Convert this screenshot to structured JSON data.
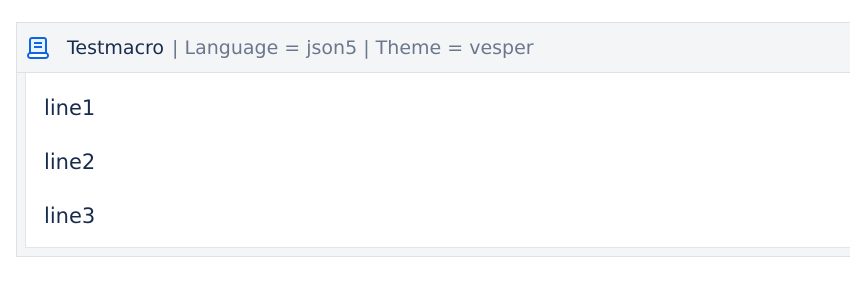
{
  "macro": {
    "icon": "scroll-icon",
    "title": "Testmacro",
    "meta": "| Language = json5 | Theme = vesper",
    "lines": [
      "line1",
      "line2",
      "line3"
    ]
  },
  "colors": {
    "title": "#172b4d",
    "meta": "#6b778c",
    "header_bg": "#f4f5f7",
    "border": "#dfe1e5"
  }
}
